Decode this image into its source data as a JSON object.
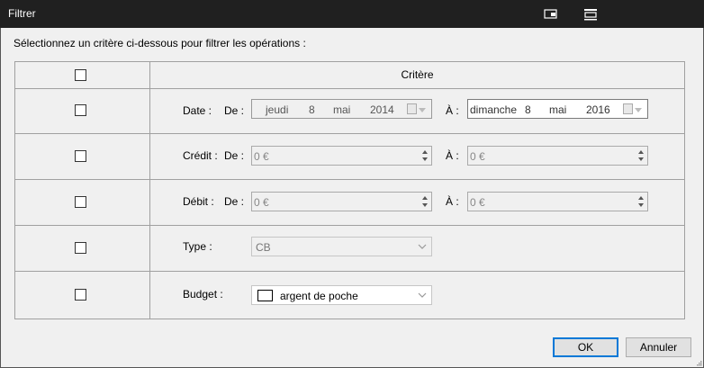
{
  "window": {
    "title": "Filtrer"
  },
  "instruction": "Sélectionnez un critère ci-dessous pour filtrer les opérations :",
  "header": {
    "criteria_label": "Critère"
  },
  "rows": {
    "date": {
      "label": "Date :",
      "from_label": "De :",
      "to_label": "À :",
      "from": {
        "weekday": "jeudi",
        "day": "8",
        "month": "mai",
        "year": "2014"
      },
      "to": {
        "weekday": "dimanche",
        "day": "8",
        "month": "mai",
        "year": "2016"
      }
    },
    "credit": {
      "label": "Crédit :",
      "from_label": "De :",
      "to_label": "À :",
      "from_value": "0 €",
      "to_value": "0 €"
    },
    "debit": {
      "label": "Débit :",
      "from_label": "De :",
      "to_label": "À :",
      "from_value": "0 €",
      "to_value": "0 €"
    },
    "type": {
      "label": "Type :",
      "value": "CB"
    },
    "budget": {
      "label": "Budget :",
      "value": "argent de poche",
      "swatch_color": "#ffffff"
    }
  },
  "buttons": {
    "ok": "OK",
    "cancel": "Annuler"
  },
  "colors": {
    "titlebar": "#202020",
    "background": "#f0f0f0",
    "default_button_border": "#0078d7"
  }
}
